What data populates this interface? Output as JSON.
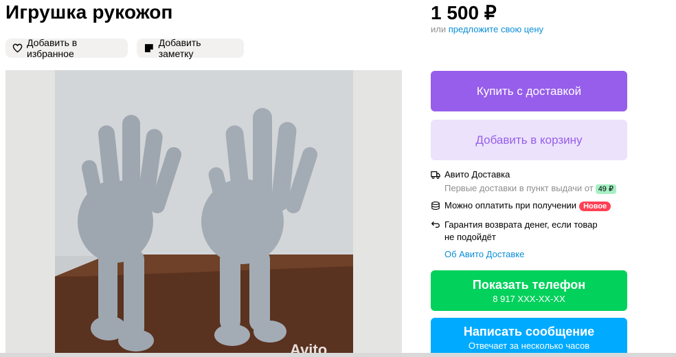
{
  "listing": {
    "title": "Игрушка рукожоп",
    "price": "1 500 ₽",
    "offer_prefix": "или",
    "offer_link": "предложите свою цену"
  },
  "actions": {
    "favorite_label": "Добавить в избранное",
    "note_label": "Добавить заметку"
  },
  "photo": {
    "watermark": "Avito"
  },
  "buttons": {
    "buy": "Купить с доставкой",
    "cart": "Добавить в корзину",
    "phone_label": "Показать телефон",
    "phone_number": "8 917 XXX-XX-XX",
    "message_label": "Написать сообщение",
    "message_sub": "Отвечает за несколько часов"
  },
  "delivery": {
    "title": "Авито Доставка",
    "subtitle": "Первые доставки в пункт выдачи от",
    "price_badge": "49 ₽",
    "pay_on_receipt": "Можно оплатить при получении",
    "new_badge": "Новое",
    "guarantee_line1": "Гарантия возврата денег, если товар",
    "guarantee_line2": "не подойдёт",
    "about_link": "Об Авито Доставке"
  },
  "colors": {
    "purple": "#965eeb",
    "purple_light": "#ece2fc",
    "green": "#02d15c",
    "blue": "#00aaff",
    "link": "#0a8ed6"
  },
  "icons": [
    "heart-icon",
    "note-icon",
    "truck-icon",
    "coins-icon",
    "return-arrow-icon"
  ]
}
